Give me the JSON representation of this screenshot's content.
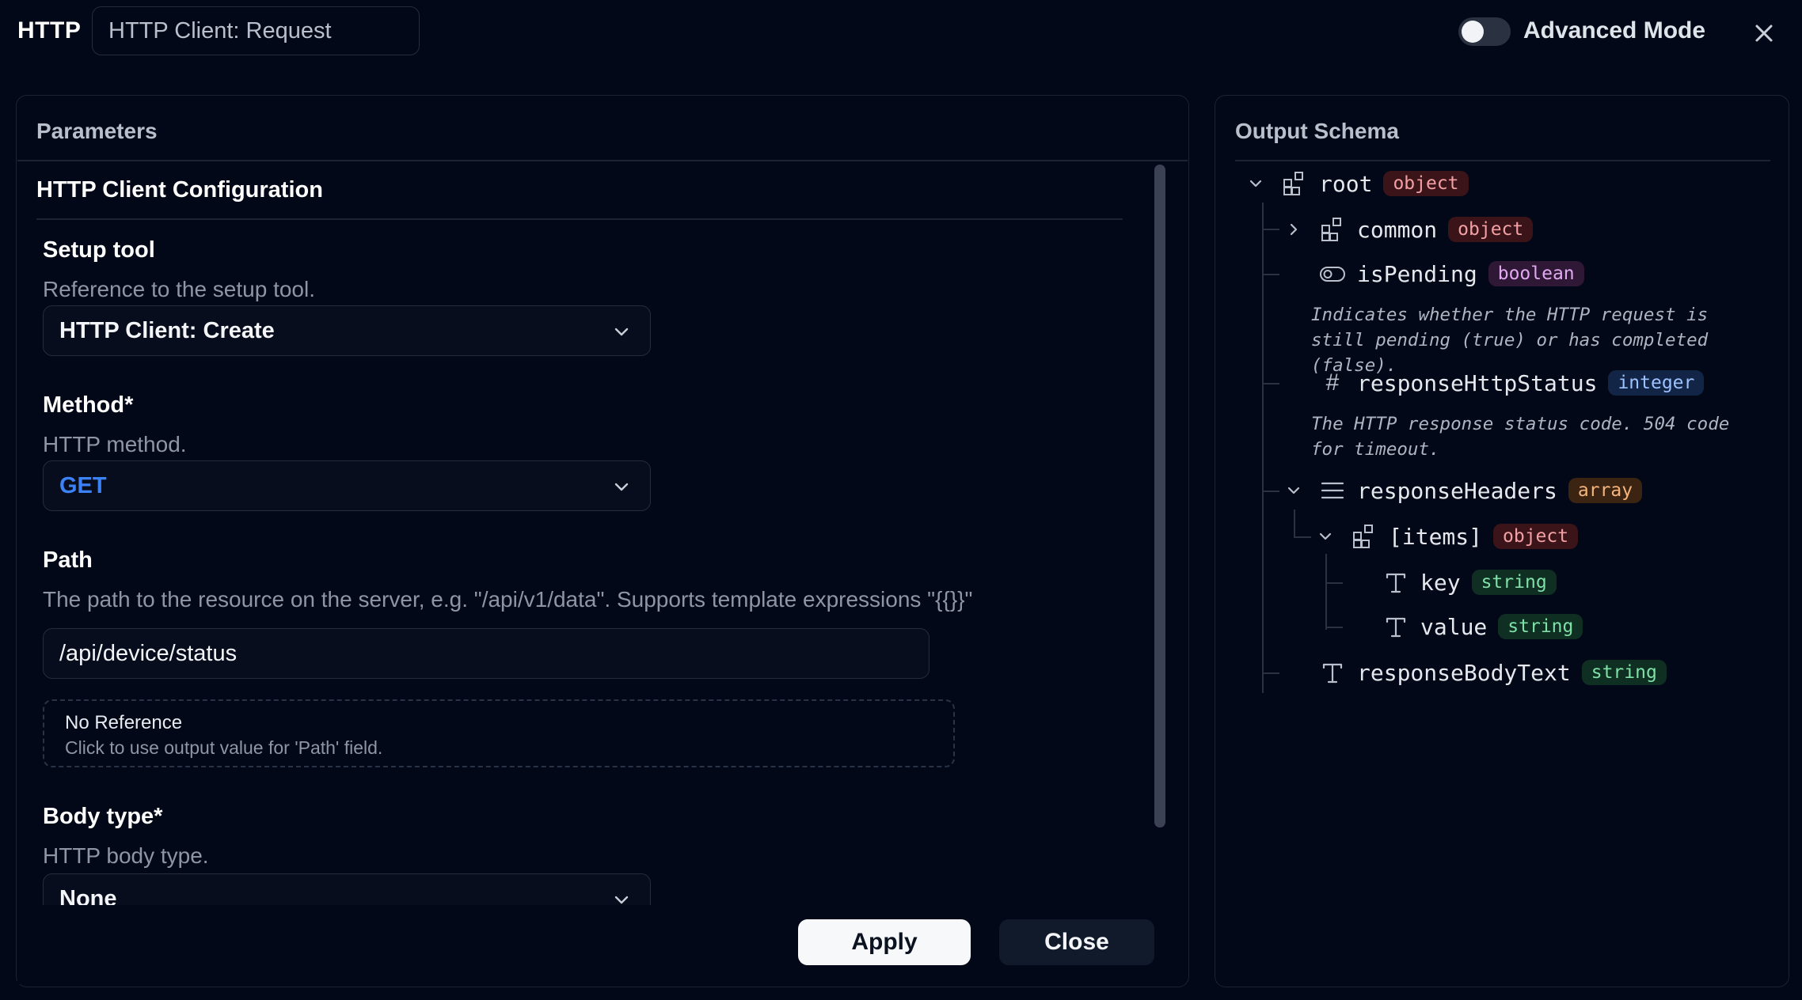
{
  "header": {
    "brand": "HTTP",
    "name_value": "HTTP Client: Request",
    "advanced_mode_label": "Advanced Mode",
    "advanced_mode_on": false
  },
  "parameters": {
    "panel_title": "Parameters",
    "section_title": "HTTP Client Configuration",
    "setup_tool": {
      "label": "Setup tool",
      "description": "Reference to the setup tool.",
      "value": "HTTP Client: Create"
    },
    "method": {
      "label": "Method*",
      "description": "HTTP method.",
      "value": "GET"
    },
    "path": {
      "label": "Path",
      "description": "The path to the resource on the server, e.g. \"/api/v1/data\". Supports template expressions \"{{}}\"",
      "value": "/api/device/status",
      "reference_title": "No Reference",
      "reference_hint": "Click to use output value for 'Path' field."
    },
    "body_type": {
      "label": "Body type*",
      "description": "HTTP body type.",
      "value": "None"
    }
  },
  "actions": {
    "apply_label": "Apply",
    "close_label": "Close"
  },
  "schema": {
    "panel_title": "Output Schema",
    "nodes": [
      {
        "name": "root",
        "type": "object",
        "icon": "object-icon",
        "expanded": true
      },
      {
        "name": "common",
        "type": "object",
        "icon": "object-icon",
        "expanded": false
      },
      {
        "name": "isPending",
        "type": "boolean",
        "icon": "toggle-icon",
        "description": "Indicates whether the HTTP request is still pending (true) or has completed (false)."
      },
      {
        "name": "responseHttpStatus",
        "type": "integer",
        "icon": "hash-icon",
        "description": "The HTTP response status code. 504 code for timeout."
      },
      {
        "name": "responseHeaders",
        "type": "array",
        "icon": "list-icon",
        "expanded": true
      },
      {
        "name": "[items]",
        "type": "object",
        "icon": "object-icon",
        "expanded": true
      },
      {
        "name": "key",
        "type": "string",
        "icon": "text-icon"
      },
      {
        "name": "value",
        "type": "string",
        "icon": "text-icon"
      },
      {
        "name": "responseBodyText",
        "type": "string",
        "icon": "text-icon"
      }
    ]
  },
  "colors": {
    "background": "#020817",
    "accent_blue": "#3b82f6",
    "object_badge": "#3a1418",
    "string_badge": "#0f2f22"
  }
}
